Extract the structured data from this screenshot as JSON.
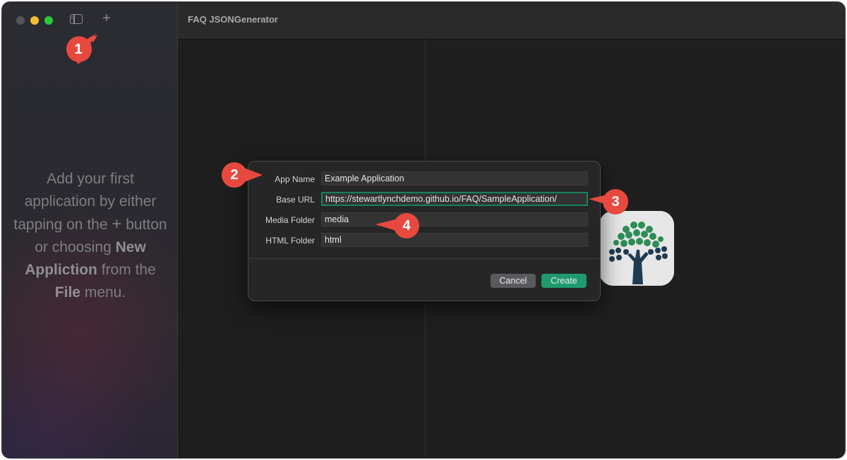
{
  "window": {
    "title": "FAQ JSONGenerator"
  },
  "sidebar": {
    "empty_text_1": "Add your first application by either tapping on the",
    "empty_plus": "+",
    "empty_text_2": "button or choosing",
    "empty_bold_1": "New Appliction",
    "empty_text_3": "from the",
    "empty_bold_2": "File",
    "empty_text_4": "menu.",
    "plus_label": "+"
  },
  "dialog": {
    "fields": [
      {
        "label": "App Name",
        "value": "Example Application"
      },
      {
        "label": "Base URL",
        "value": "https://stewartlynchdemo.github.io/FAQ/SampleApplication/"
      },
      {
        "label": "Media Folder",
        "value": "media"
      },
      {
        "label": "HTML Folder",
        "value": "html"
      }
    ],
    "cancel_label": "Cancel",
    "create_label": "Create"
  },
  "callouts": [
    "1",
    "2",
    "3",
    "4"
  ],
  "colors": {
    "accent_green": "#1f9a6e",
    "callout_red": "#e8493f",
    "traffic_yellow": "#f6bc30",
    "traffic_green": "#2bc840"
  }
}
